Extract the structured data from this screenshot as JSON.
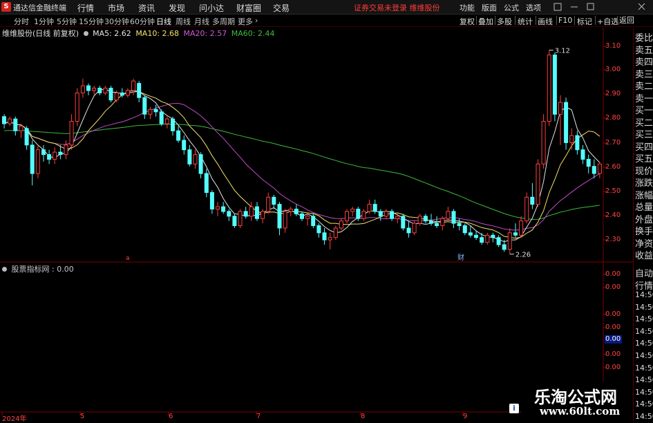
{
  "app": {
    "logo": "S",
    "name": "通达信金融终端"
  },
  "menu": [
    "行情",
    "市场",
    "资讯",
    "发现",
    "问小达",
    "财富圈",
    "交易"
  ],
  "warning": "证券交易未登录  维维股份",
  "top_right": [
    "功能",
    "版面",
    "公式",
    "选项"
  ],
  "periods": [
    "分时",
    "1分钟",
    "5分钟",
    "15分钟",
    "30分钟",
    "60分钟",
    "日线",
    "周线",
    "月线",
    "多周期",
    "更多"
  ],
  "active_period": "日线",
  "right_toolbar": [
    "复权",
    "叠加",
    "多股",
    "统计",
    "画线",
    "F10",
    "标记",
    "+自选",
    "返回"
  ],
  "chart_title": {
    "stock": "维维股份(日线 前复权)",
    "ma5": "MA5: 2.62",
    "ma10": "MA10: 2.68",
    "ma20": "MA20: 2.57",
    "ma60": "MA60: 2.44"
  },
  "price_axis": [
    "3.10",
    "3.00",
    "2.90",
    "2.80",
    "2.70",
    "2.60",
    "2.50",
    "2.40",
    "2.30"
  ],
  "indicator": {
    "title": "股票指标网 : 0.00",
    "axis": [
      "0.00",
      "0.00",
      "0.00",
      "0.00",
      "0.00",
      "0.00"
    ],
    "selected": "0.00"
  },
  "x_labels": [
    "2024年",
    "5",
    "6",
    "7",
    "8",
    "9"
  ],
  "right_panel": [
    "委比",
    "卖五",
    "卖四",
    "卖三",
    "卖二",
    "卖一",
    "买一",
    "买二",
    "买三",
    "买四",
    "买五",
    "现价",
    "涨跌",
    "涨幅",
    "总量",
    "外盘",
    "换手",
    "净资",
    "收益",
    "自动",
    "行情",
    "14:50",
    "14:50",
    "14:50",
    "14:50",
    "14:50",
    "14:50",
    "14:50",
    "14:50",
    "14:50",
    "14:50",
    "14:50"
  ],
  "watermark": {
    "title": "乐淘公式网",
    "url": "www.60lt.com"
  },
  "markers": {
    "high": "3.12",
    "low": "2.26",
    "red_mark": "a",
    "cai_mark": "财"
  },
  "colors": {
    "up": "#ff4040",
    "down": "#54ffff",
    "ma5": "#e6e6e6",
    "ma10": "#f5e26a",
    "ma20": "#c04cc8",
    "ma60": "#3cbc3c"
  },
  "chart_data": {
    "type": "candlestick",
    "ylim": [
      2.23,
      3.18
    ],
    "candles": [
      [
        2.84,
        2.85,
        2.79,
        2.81
      ],
      [
        2.81,
        2.84,
        2.8,
        2.83
      ],
      [
        2.83,
        2.84,
        2.76,
        2.78
      ],
      [
        2.78,
        2.81,
        2.75,
        2.8
      ],
      [
        2.79,
        2.8,
        2.7,
        2.72
      ],
      [
        2.72,
        2.74,
        2.55,
        2.6
      ],
      [
        2.6,
        2.72,
        2.58,
        2.7
      ],
      [
        2.7,
        2.72,
        2.65,
        2.68
      ],
      [
        2.68,
        2.7,
        2.64,
        2.66
      ],
      [
        2.66,
        2.71,
        2.64,
        2.69
      ],
      [
        2.69,
        2.72,
        2.66,
        2.68
      ],
      [
        2.68,
        2.74,
        2.66,
        2.72
      ],
      [
        2.72,
        2.85,
        2.7,
        2.82
      ],
      [
        2.82,
        2.96,
        2.8,
        2.94
      ],
      [
        2.94,
        3.0,
        2.92,
        2.97
      ],
      [
        2.97,
        2.98,
        2.93,
        2.95
      ],
      [
        2.95,
        2.97,
        2.93,
        2.96
      ],
      [
        2.96,
        2.97,
        2.93,
        2.94
      ],
      [
        2.94,
        2.97,
        2.93,
        2.96
      ],
      [
        2.96,
        2.97,
        2.9,
        2.91
      ],
      [
        2.91,
        2.95,
        2.9,
        2.94
      ],
      [
        2.94,
        2.96,
        2.92,
        2.93
      ],
      [
        2.93,
        2.96,
        2.92,
        2.95
      ],
      [
        2.95,
        3.0,
        2.93,
        2.99
      ],
      [
        2.98,
        2.99,
        2.9,
        2.92
      ],
      [
        2.92,
        2.93,
        2.83,
        2.85
      ],
      [
        2.85,
        2.88,
        2.83,
        2.87
      ],
      [
        2.87,
        2.89,
        2.84,
        2.86
      ],
      [
        2.86,
        2.87,
        2.8,
        2.81
      ],
      [
        2.81,
        2.84,
        2.79,
        2.83
      ],
      [
        2.83,
        2.84,
        2.76,
        2.78
      ],
      [
        2.78,
        2.8,
        2.73,
        2.74
      ],
      [
        2.74,
        2.76,
        2.68,
        2.7
      ],
      [
        2.7,
        2.72,
        2.63,
        2.64
      ],
      [
        2.64,
        2.7,
        2.62,
        2.68
      ],
      [
        2.68,
        2.69,
        2.58,
        2.6
      ],
      [
        2.6,
        2.62,
        2.5,
        2.52
      ],
      [
        2.52,
        2.53,
        2.43,
        2.45
      ],
      [
        2.45,
        2.48,
        2.42,
        2.46
      ],
      [
        2.46,
        2.48,
        2.43,
        2.44
      ],
      [
        2.44,
        2.45,
        2.4,
        2.42
      ],
      [
        2.42,
        2.43,
        2.37,
        2.38
      ],
      [
        2.38,
        2.45,
        2.37,
        2.44
      ],
      [
        2.44,
        2.46,
        2.41,
        2.42
      ],
      [
        2.42,
        2.48,
        2.4,
        2.46
      ],
      [
        2.46,
        2.48,
        2.4,
        2.41
      ],
      [
        2.41,
        2.45,
        2.39,
        2.44
      ],
      [
        2.44,
        2.52,
        2.43,
        2.5
      ],
      [
        2.5,
        2.51,
        2.45,
        2.47
      ],
      [
        2.47,
        2.48,
        2.34,
        2.37
      ],
      [
        2.37,
        2.45,
        2.35,
        2.44
      ],
      [
        2.44,
        2.46,
        2.42,
        2.45
      ],
      [
        2.45,
        2.47,
        2.42,
        2.43
      ],
      [
        2.43,
        2.44,
        2.4,
        2.41
      ],
      [
        2.41,
        2.43,
        2.38,
        2.42
      ],
      [
        2.42,
        2.43,
        2.37,
        2.38
      ],
      [
        2.38,
        2.39,
        2.33,
        2.35
      ],
      [
        2.35,
        2.37,
        2.3,
        2.32
      ],
      [
        2.32,
        2.35,
        2.28,
        2.33
      ],
      [
        2.33,
        2.38,
        2.32,
        2.37
      ],
      [
        2.37,
        2.41,
        2.36,
        2.4
      ],
      [
        2.4,
        2.45,
        2.39,
        2.44
      ],
      [
        2.44,
        2.46,
        2.42,
        2.45
      ],
      [
        2.45,
        2.46,
        2.4,
        2.41
      ],
      [
        2.41,
        2.45,
        2.4,
        2.44
      ],
      [
        2.44,
        2.49,
        2.43,
        2.47
      ],
      [
        2.47,
        2.49,
        2.43,
        2.44
      ],
      [
        2.44,
        2.45,
        2.4,
        2.42
      ],
      [
        2.42,
        2.45,
        2.41,
        2.44
      ],
      [
        2.44,
        2.45,
        2.4,
        2.41
      ],
      [
        2.41,
        2.43,
        2.39,
        2.42
      ],
      [
        2.42,
        2.43,
        2.36,
        2.37
      ],
      [
        2.37,
        2.4,
        2.33,
        2.35
      ],
      [
        2.35,
        2.4,
        2.34,
        2.39
      ],
      [
        2.39,
        2.43,
        2.38,
        2.42
      ],
      [
        2.42,
        2.43,
        2.39,
        2.4
      ],
      [
        2.4,
        2.43,
        2.38,
        2.39
      ],
      [
        2.39,
        2.42,
        2.37,
        2.38
      ],
      [
        2.38,
        2.42,
        2.36,
        2.41
      ],
      [
        2.41,
        2.46,
        2.4,
        2.44
      ],
      [
        2.44,
        2.45,
        2.37,
        2.39
      ],
      [
        2.39,
        2.41,
        2.36,
        2.38
      ],
      [
        2.38,
        2.39,
        2.34,
        2.35
      ],
      [
        2.35,
        2.38,
        2.33,
        2.34
      ],
      [
        2.34,
        2.36,
        2.32,
        2.33
      ],
      [
        2.33,
        2.35,
        2.3,
        2.31
      ],
      [
        2.31,
        2.35,
        2.3,
        2.34
      ],
      [
        2.34,
        2.35,
        2.31,
        2.33
      ],
      [
        2.33,
        2.34,
        2.29,
        2.3
      ],
      [
        2.3,
        2.32,
        2.27,
        2.28
      ],
      [
        2.28,
        2.37,
        2.26,
        2.35
      ],
      [
        2.35,
        2.39,
        2.33,
        2.34
      ],
      [
        2.34,
        2.42,
        2.33,
        2.4
      ],
      [
        2.4,
        2.52,
        2.39,
        2.5
      ],
      [
        2.5,
        2.56,
        2.45,
        2.47
      ],
      [
        2.47,
        2.66,
        2.46,
        2.64
      ],
      [
        2.64,
        2.85,
        2.62,
        2.82
      ],
      [
        2.82,
        3.12,
        2.8,
        3.1
      ],
      [
        3.1,
        3.11,
        2.82,
        2.85
      ],
      [
        2.85,
        2.93,
        2.72,
        2.9
      ],
      [
        2.9,
        2.92,
        2.7,
        2.73
      ],
      [
        2.73,
        2.79,
        2.7,
        2.76
      ],
      [
        2.76,
        2.78,
        2.68,
        2.7
      ],
      [
        2.7,
        2.72,
        2.64,
        2.66
      ],
      [
        2.66,
        2.68,
        2.6,
        2.63
      ],
      [
        2.63,
        2.66,
        2.58,
        2.6
      ],
      [
        2.6,
        2.65,
        2.58,
        2.64
      ]
    ]
  }
}
